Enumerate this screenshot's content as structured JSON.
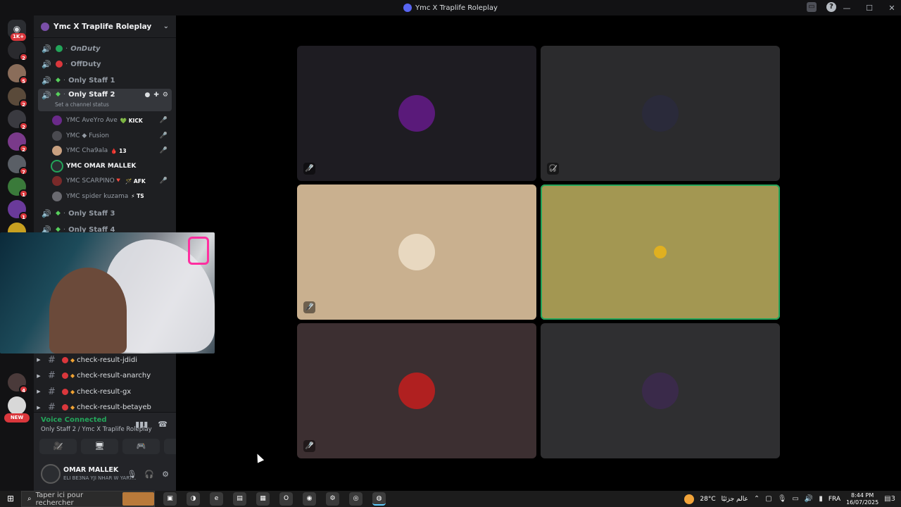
{
  "window": {
    "title": "Ymc X Traplife Roleplay",
    "controls": [
      "—",
      "☐",
      "✕"
    ]
  },
  "rail": {
    "home_badge": "1K+",
    "servers": [
      {
        "badge": "2",
        "color": "#2a2a2e"
      },
      {
        "badge": "5",
        "color": "#8a6d5a"
      },
      {
        "badge": "2",
        "color": "#5a4a3a"
      },
      {
        "badge": "2",
        "color": "#3a3a40"
      },
      {
        "badge": "2",
        "color": "#7a3a8a"
      },
      {
        "badge": "7",
        "color": "#5a5f66"
      },
      {
        "badge": "1",
        "color": "#3a7a3a"
      },
      {
        "badge": "1",
        "color": "#6a3a9a"
      },
      {
        "badge": "",
        "color": "#c8a020"
      },
      {
        "badge": "4",
        "color": "#4a3a3a"
      },
      {
        "badge": "",
        "color": "#d8d8d8"
      }
    ],
    "new_label": "NEW"
  },
  "guild": {
    "name": "Ymc X Traplife Roleplay"
  },
  "channels": [
    {
      "label": "OnDuty",
      "dot": "#23a55a",
      "italic": true
    },
    {
      "label": "OffDuty",
      "dot": "#da373c",
      "italic": false
    },
    {
      "label": "Only Staff 1",
      "leaf": true
    },
    {
      "label": "Only Staff 2",
      "leaf": true,
      "active": true,
      "status_hint": "Set a channel status"
    }
  ],
  "members": [
    {
      "prefix": "YMC",
      "name": "AveYro Ave",
      "tag": "💚 KICK",
      "avatar": "#6a2a8a",
      "muted": true
    },
    {
      "prefix": "YMC",
      "name": "◆ Fusion",
      "tag": "",
      "avatar": "#4a4a50",
      "muted": true
    },
    {
      "prefix": "YMC",
      "name": "Cha9ala",
      "tag": "🩸 13",
      "avatar": "#c8a080",
      "muted": true
    },
    {
      "prefix": "YMC",
      "name": "OMAR MALLEK",
      "tag": "",
      "avatar": "#2b2d31",
      "muted": false,
      "speaking": true
    },
    {
      "prefix": "YMC",
      "name": "SCARPINO🔻",
      "tag": "🪄 AFK",
      "avatar": "#7a2a2a",
      "muted": true
    },
    {
      "prefix": "YMC",
      "name": "spider kuzama",
      "tag": "⚡ TS",
      "avatar": "#6a6a70",
      "muted": false
    }
  ],
  "channels_after": [
    {
      "label": "Only Staff 3"
    },
    {
      "label": "Only Staff 4"
    }
  ],
  "text_channels": [
    {
      "label": "check-result-jdidi"
    },
    {
      "label": "check-result-anarchy"
    },
    {
      "label": "check-result-gx"
    },
    {
      "label": "check-result-betayeb"
    }
  ],
  "voice": {
    "title": "Voice Connected",
    "subtitle": "Only Staff 2 / Ymc X Traplife Roleplay",
    "buttons": [
      "🎥̸",
      "🖥",
      "🎮",
      "🚀"
    ]
  },
  "user": {
    "name": "OMAR MALLEK",
    "status": "ELI BE3NA YJI NHAR W YART..."
  },
  "tiles": [
    {
      "bg": "#1e1c22",
      "avatar": "#5a1a7a",
      "muted": true,
      "speaking": false,
      "mute_icon": "🎤̸"
    },
    {
      "bg": "#2b2b2d",
      "avatar": "#2a2a3a",
      "muted": true,
      "speaking": false,
      "mute_icon": "🎧̸"
    },
    {
      "bg": "#c9b08f",
      "avatar": "#e8d8c0",
      "muted": true,
      "speaking": false,
      "mute_icon": "🎤̸"
    },
    {
      "bg": "#a39752",
      "avatar": "#a39752",
      "muted": false,
      "speaking": true,
      "mute_icon": ""
    },
    {
      "bg": "#3c2f31",
      "avatar": "#b02020",
      "muted": true,
      "speaking": false,
      "mute_icon": "🎤̸"
    },
    {
      "bg": "#2f2f31",
      "avatar": "#3a2a4a",
      "muted": false,
      "speaking": false,
      "mute_icon": ""
    }
  ],
  "taskbar": {
    "search_placeholder": "Taper ici pour rechercher",
    "weather_temp": "28°C",
    "weather_text": "عالم جزئيًا",
    "language": "FRA",
    "time": "8:44 PM",
    "date": "16/07/2025",
    "notif_count": "3"
  }
}
